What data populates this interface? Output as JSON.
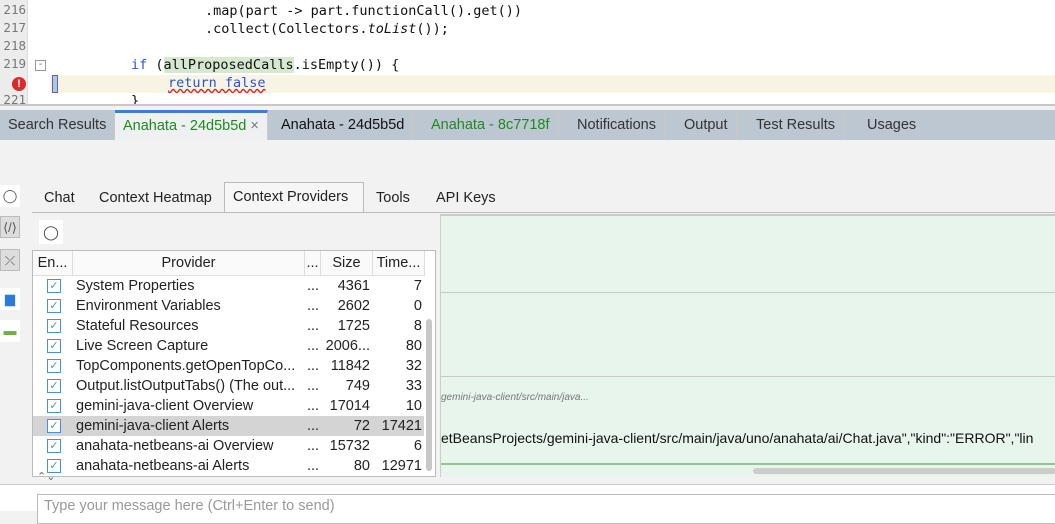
{
  "editor": {
    "lines": [
      {
        "num": "216",
        "code": ".map(part -> part.functionCall().get())"
      },
      {
        "num": "217",
        "code_a": ".collect(Collectors.",
        "code_b": "toList",
        "code_c": "());"
      },
      {
        "num": "218"
      },
      {
        "num": "219",
        "kw": "if",
        "paren": " (",
        "var": "allProposedCalls",
        "rest": ".isEmpty()) {"
      },
      {
        "err_code": "return false"
      },
      {
        "num": "221",
        "code": "}"
      }
    ]
  },
  "output_tabs": [
    {
      "label": "Search Results"
    },
    {
      "label": "Anahata - 24d5b5d",
      "close": "×"
    },
    {
      "label": "Anahata - 24d5b5d"
    },
    {
      "label": "Anahata - 8c7718f"
    },
    {
      "label": "Notifications"
    },
    {
      "label": "Output"
    },
    {
      "label": "Test Results"
    },
    {
      "label": "Usages"
    }
  ],
  "inner_tabs": [
    "Chat",
    "Context Heatmap",
    "Context Providers",
    "Tools",
    "API Keys"
  ],
  "table": {
    "headers": [
      "En...",
      "Provider",
      "...",
      "Size",
      "Time..."
    ],
    "rows": [
      {
        "provider": "System Properties",
        "dots": "...",
        "size": "4361",
        "time": "7"
      },
      {
        "provider": "Environment Variables",
        "dots": "...",
        "size": "2602",
        "time": "0"
      },
      {
        "provider": "Stateful Resources",
        "dots": "...",
        "size": "1725",
        "time": "8"
      },
      {
        "provider": "Live Screen Capture",
        "dots": "...",
        "size": "2006...",
        "time": "80"
      },
      {
        "provider": "TopComponents.getOpenTopCo...",
        "dots": "...",
        "size": "11842",
        "time": "32"
      },
      {
        "provider": "Output.listOutputTabs() (The out...",
        "dots": "...",
        "size": "749",
        "time": "33"
      },
      {
        "provider": "gemini-java-client Overview",
        "dots": "...",
        "size": "17014",
        "time": "10"
      },
      {
        "provider": "gemini-java-client Alerts",
        "dots": "...",
        "size": "72",
        "time": "17421"
      },
      {
        "provider": "anahata-netbeans-ai Overview",
        "dots": "...",
        "size": "15732",
        "time": "6"
      },
      {
        "provider": "anahata-netbeans-ai Alerts",
        "dots": "...",
        "size": "80",
        "time": "12971"
      }
    ]
  },
  "detail": {
    "path_hint": "gemini-java-client/src/main/java...",
    "content": "etBeansProjects/gemini-java-client/src/main/java/uno/anahata/ai/Chat.java\",\"kind\":\"ERROR\",\"lin"
  },
  "input": {
    "placeholder": "Type your message here (Ctrl+Enter to send)"
  }
}
